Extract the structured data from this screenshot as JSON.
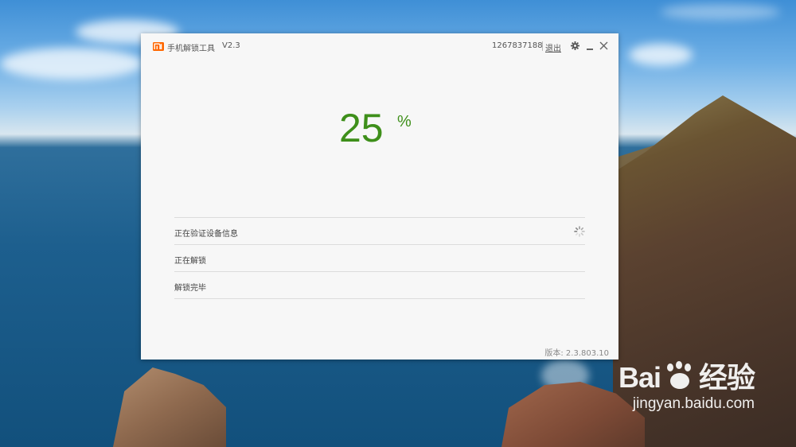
{
  "app": {
    "title": "手机解锁工具",
    "version": "V2.3",
    "account": "1267837188",
    "logout_label": "退出",
    "build_version": "版本: 2.3.803.10",
    "brand_color": "#ff6700"
  },
  "progress": {
    "value": "25",
    "unit": "%",
    "color": "#3e8f1a"
  },
  "steps": [
    {
      "label": "正在验证设备信息",
      "status": "in-progress"
    },
    {
      "label": "正在解锁",
      "status": "pending"
    },
    {
      "label": "解锁完毕",
      "status": "pending"
    }
  ],
  "watermark": {
    "logo": "Bai",
    "logo_suffix": "经验",
    "url": "jingyan.baidu.com"
  },
  "icons": {
    "logo": "mi-logo-icon",
    "settings": "gear-icon",
    "minimize": "minimize-icon",
    "close": "close-icon",
    "loading": "spinner-icon"
  }
}
